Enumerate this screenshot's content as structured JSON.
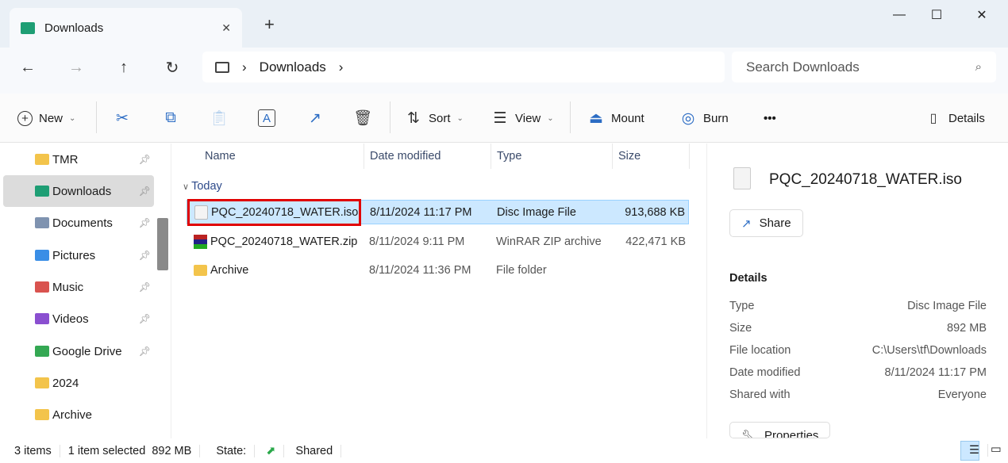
{
  "window": {
    "tab_title": "Downloads",
    "new_tab": "+",
    "minimize": "—",
    "maximize": "☐",
    "close": "✕"
  },
  "nav": {
    "back": "←",
    "forward": "→",
    "up": "↑",
    "refresh": "↻",
    "breadcrumb": [
      "Downloads"
    ],
    "search_placeholder": "Search Downloads"
  },
  "toolbar": {
    "new": "New",
    "sort": "Sort",
    "view": "View",
    "mount": "Mount",
    "burn": "Burn",
    "more": "•••",
    "details": "Details"
  },
  "sidebar": {
    "items": [
      {
        "label": "TMR",
        "color": "#f3c44b"
      },
      {
        "label": "Downloads",
        "color": "#1e9e74",
        "selected": true
      },
      {
        "label": "Documents",
        "color": "#7f93b0"
      },
      {
        "label": "Pictures",
        "color": "#3a8ee6"
      },
      {
        "label": "Music",
        "color": "#d9534f"
      },
      {
        "label": "Videos",
        "color": "#8a4fd0"
      },
      {
        "label": "Google Drive",
        "color": "#34a853"
      },
      {
        "label": "2024",
        "color": "#f3c44b"
      },
      {
        "label": "Archive",
        "color": "#f3c44b"
      }
    ]
  },
  "list": {
    "columns": [
      "Name",
      "Date modified",
      "Type",
      "Size"
    ],
    "group": "Today",
    "rows": [
      {
        "name": "PQC_20240718_WATER.iso",
        "date": "8/11/2024 11:17 PM",
        "type": "Disc Image File",
        "size": "913,688 KB",
        "icon": "disc-image-icon",
        "selected": true
      },
      {
        "name": "PQC_20240718_WATER.zip",
        "date": "8/11/2024 9:11 PM",
        "type": "WinRAR ZIP archive",
        "size": "422,471 KB",
        "icon": "winrar-icon"
      },
      {
        "name": "Archive",
        "date": "8/11/2024 11:36 PM",
        "type": "File folder",
        "size": "",
        "icon": "folder-icon"
      }
    ]
  },
  "details": {
    "title": "PQC_20240718_WATER.iso",
    "share": "Share",
    "heading": "Details",
    "props": [
      {
        "label": "Type",
        "value": "Disc Image File"
      },
      {
        "label": "Size",
        "value": "892 MB"
      },
      {
        "label": "File location",
        "value": "C:\\Users\\tf\\Downloads"
      },
      {
        "label": "Date modified",
        "value": "8/11/2024 11:17 PM"
      },
      {
        "label": "Shared with",
        "value": "Everyone"
      }
    ],
    "properties": "Properties"
  },
  "status": {
    "items": "3 items",
    "selected": "1 item selected  892 MB",
    "state_label": "State:",
    "state": "Shared"
  }
}
